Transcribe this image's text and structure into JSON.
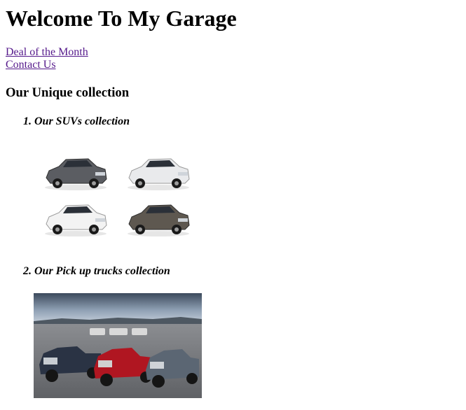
{
  "page": {
    "title": "Welcome To My Garage"
  },
  "nav": {
    "links": [
      {
        "label": "Deal of the Month"
      },
      {
        "label": "Contact Us"
      }
    ]
  },
  "collection": {
    "heading": "Our Unique collection",
    "items": [
      {
        "label": "1. Our SUVs collection",
        "images": [
          {
            "color": "#5b5d62",
            "icon": "suv-icon"
          },
          {
            "color": "#e9eaec",
            "icon": "suv-icon"
          },
          {
            "color": "#f3f3f3",
            "icon": "suv-icon"
          },
          {
            "color": "#5e5850",
            "icon": "suv-icon"
          }
        ]
      },
      {
        "label": "2. Our Pick up trucks collection",
        "image": {
          "icon": "pickup-trucks-photo",
          "truck_colors": [
            "#2a3344",
            "#b01621",
            "#5b6673"
          ]
        }
      }
    ]
  }
}
